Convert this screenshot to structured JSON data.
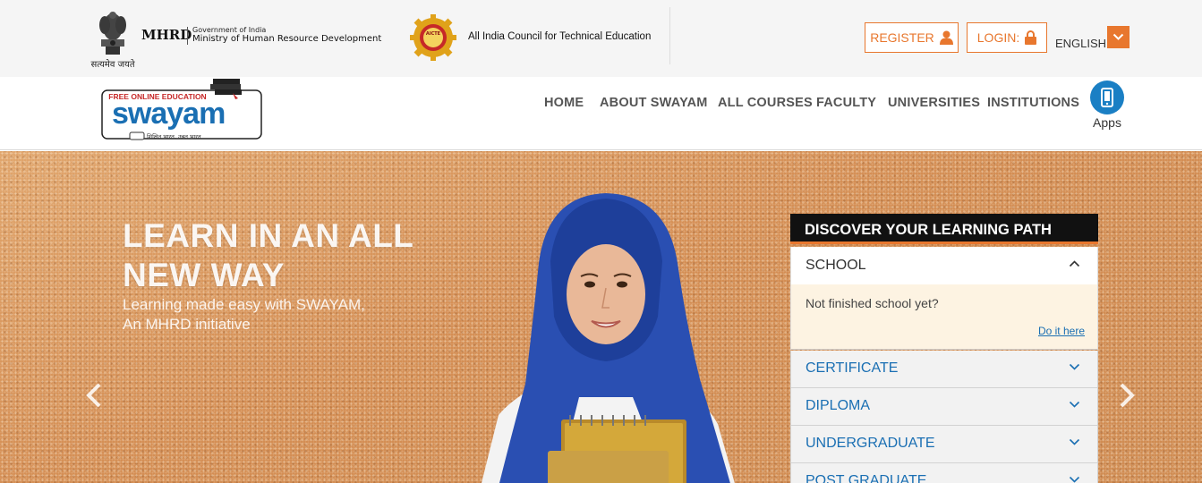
{
  "gov_bar": {
    "emblem_caption": "सत्यमेव जयते",
    "mhrd_short": "MHRD",
    "gov_of_india": "Government of India",
    "ministry": "Ministry of Human Resource Development",
    "aicte_logo_text": "AICTE",
    "aicte_name": "All India Council for Technical Education",
    "register_label": "REGISTER",
    "register_icon": "user-icon",
    "login_label": "LOGIN:",
    "login_icon": "lock-icon",
    "language": "ENGLISH",
    "language_icon": "chevron-down-icon"
  },
  "nav": {
    "logo": {
      "tagline_top": "FREE ONLINE EDUCATION",
      "brand": "swayam",
      "tagline_bottom": "शिक्षित भारत, उन्नत भारत"
    },
    "menu": [
      "HOME",
      "ABOUT SWAYAM",
      "ALL COURSES",
      "FACULTY",
      "UNIVERSITIES",
      "INSTITUTIONS"
    ],
    "apps_label": "Apps",
    "apps_icon": "mobile-phone-icon"
  },
  "hero": {
    "title_line1": "LEARN IN AN ALL",
    "title_line2": "NEW WAY",
    "subtitle_line1": "Learning made easy with SWAYAM,",
    "subtitle_line2": "An MHRD initiative",
    "prev_icon": "chevron-left-icon",
    "next_icon": "chevron-right-icon"
  },
  "learning_path": {
    "title": "DISCOVER YOUR LEARNING PATH",
    "open_item": {
      "label": "SCHOOL",
      "question": "Not finished school yet?",
      "link": "Do it here"
    },
    "items": [
      "CERTIFICATE",
      "DIPLOMA",
      "UNDERGRADUATE",
      "POST GRADUATE"
    ]
  },
  "colors": {
    "accent_orange": "#e8772e",
    "link_blue": "#1a6fb3",
    "apps_blue": "#1a7fc4",
    "panel_header": "#111111",
    "open_body_bg": "#fdf3e2"
  }
}
